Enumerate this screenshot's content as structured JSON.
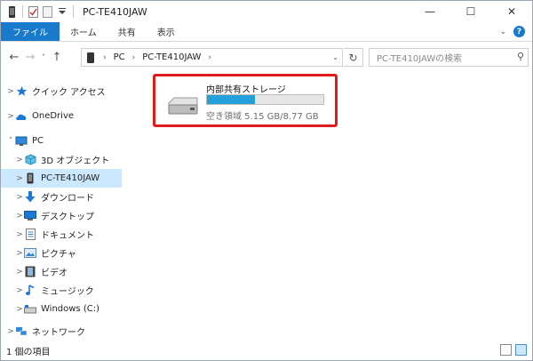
{
  "window": {
    "title": "PC-TE410JAW",
    "minimize": "—",
    "maximize": "☐",
    "close": "✕"
  },
  "ribbon": {
    "tabs": [
      {
        "label": "ファイル",
        "active": true
      },
      {
        "label": "ホーム",
        "active": false
      },
      {
        "label": "共有",
        "active": false
      },
      {
        "label": "表示",
        "active": false
      }
    ],
    "collapse_icon": "chevron-down-icon",
    "help_icon": "help-icon",
    "help_label": "?"
  },
  "nav": {
    "back": "←",
    "forward": "→",
    "recent": "˅",
    "up": "↑",
    "breadcrumbs": [
      "PC",
      "PC-TE410JAW"
    ],
    "refresh": "↻",
    "search_placeholder": "PC-TE410JAWの検索"
  },
  "sidebar": {
    "items": [
      {
        "label": "クイック アクセス",
        "icon": "star-icon",
        "expand": ">",
        "level": 0
      },
      {
        "label": "OneDrive",
        "icon": "cloud-icon",
        "expand": ">",
        "level": 0
      },
      {
        "label": "PC",
        "icon": "pc-icon",
        "expand": "˅",
        "level": 0
      },
      {
        "label": "3D オブジェクト",
        "icon": "cube-icon",
        "expand": ">",
        "level": 1
      },
      {
        "label": "PC-TE410JAW",
        "icon": "tablet-icon",
        "expand": ">",
        "level": 1,
        "selected": true
      },
      {
        "label": "ダウンロード",
        "icon": "download-icon",
        "expand": ">",
        "level": 1
      },
      {
        "label": "デスクトップ",
        "icon": "desktop-icon",
        "expand": ">",
        "level": 1
      },
      {
        "label": "ドキュメント",
        "icon": "document-icon",
        "expand": ">",
        "level": 1
      },
      {
        "label": "ピクチャ",
        "icon": "pictures-icon",
        "expand": ">",
        "level": 1
      },
      {
        "label": "ビデオ",
        "icon": "video-icon",
        "expand": ">",
        "level": 1
      },
      {
        "label": "ミュージック",
        "icon": "music-icon",
        "expand": ">",
        "level": 1
      },
      {
        "label": "Windows (C:)",
        "icon": "drive-icon",
        "expand": ">",
        "level": 1
      },
      {
        "label": "ネットワーク",
        "icon": "network-icon",
        "expand": ">",
        "level": 0
      }
    ]
  },
  "content": {
    "drive": {
      "name": "内部共有ストレージ",
      "free_text": "空き領域 5.15 GB/8.77 GB",
      "used_fraction": 0.41,
      "bar_color": "#26a0da",
      "highlight_color": "#e01b1b"
    }
  },
  "status": {
    "item_count": "1 個の項目"
  },
  "colors": {
    "accent": "#1979ca",
    "selection": "#cce8ff"
  }
}
